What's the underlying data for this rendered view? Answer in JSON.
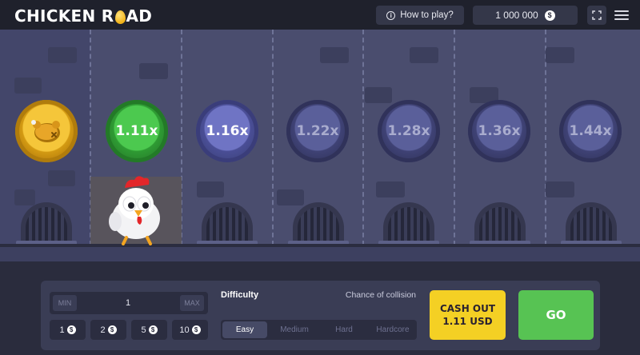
{
  "header": {
    "logo_left": "CHICKEN R",
    "logo_right": "AD",
    "how_to_play": "How to play?",
    "balance": "1 000 000",
    "currency_symbol": "$"
  },
  "game": {
    "multipliers": [
      "1.11x",
      "1.16x",
      "1.22x",
      "1.28x",
      "1.36x",
      "1.44x"
    ],
    "colors": {
      "passed_coin": "#4cc94f",
      "next_coin": "#6f74c4",
      "future_coin": "#5a5f9a",
      "start_coin": "#f5c63a"
    }
  },
  "controls": {
    "bet_min": "MIN",
    "bet_value": "1",
    "bet_max": "MAX",
    "quick_bets": [
      "1",
      "2",
      "5",
      "10"
    ],
    "difficulty_label": "Difficulty",
    "chance_label": "Chance of collision",
    "difficulties": [
      "Easy",
      "Medium",
      "Hard",
      "Hardcore"
    ],
    "selected_difficulty": "Easy",
    "cash_out_label": "CASH OUT",
    "cash_out_amount": "1.11 USD",
    "go_label": "GO",
    "colors": {
      "cash_out": "#f4d024",
      "go": "#57c353"
    }
  }
}
